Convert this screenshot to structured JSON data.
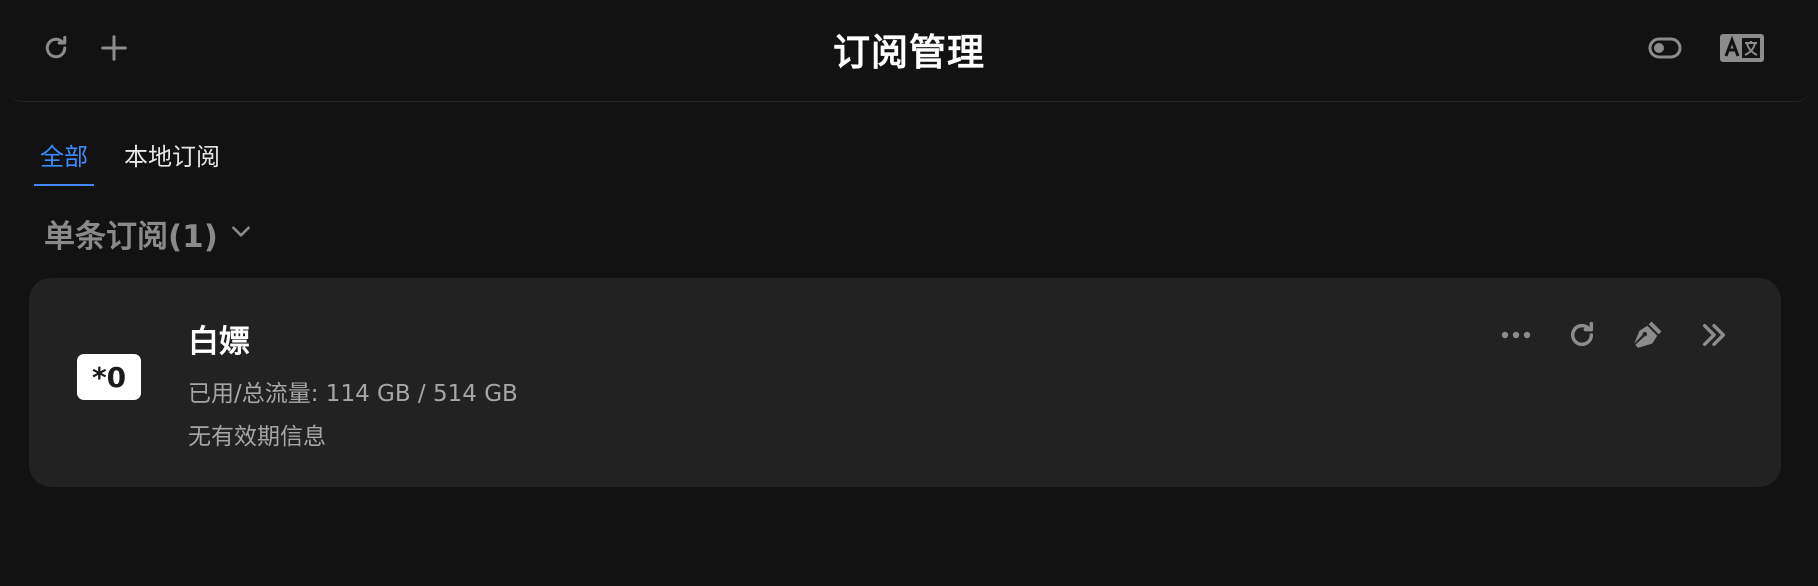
{
  "header": {
    "title": "订阅管理"
  },
  "tabs": [
    {
      "label": "全部",
      "active": true
    },
    {
      "label": "本地订阅",
      "active": false
    }
  ],
  "group": {
    "title": "单条订阅(1)"
  },
  "subscription": {
    "badge": "*0",
    "name": "白嫖",
    "traffic": "已用/总流量: 114 GB / 514 GB",
    "expiry": "无有效期信息"
  },
  "colors": {
    "accent": "#3d8bfd",
    "background": "#121212",
    "card": "#222222",
    "icon": "#8c8c8c"
  },
  "icons": {
    "header_left": [
      "refresh-icon",
      "plus-icon"
    ],
    "header_right": [
      "toggle-icon",
      "translate-icon"
    ],
    "group": "chevron-down-icon",
    "card_actions": [
      "more-icon",
      "refresh-icon",
      "edit-pen-icon",
      "double-chevron-right-icon"
    ]
  }
}
